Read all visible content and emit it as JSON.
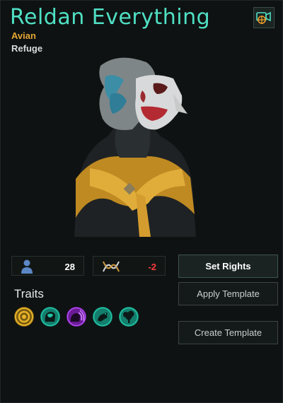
{
  "leader": {
    "name": "Reldan Everything",
    "species": "Avian",
    "rights": "Refuge"
  },
  "icons": {
    "camera_button": "camera-target-icon"
  },
  "stats": {
    "pops": {
      "icon": "person-icon",
      "value": "28"
    },
    "growth": {
      "icon": "dna-icon",
      "value": "-2"
    }
  },
  "traits": {
    "title": "Traits",
    "items": [
      {
        "icon": "ring-gear-trait-icon",
        "color": "#d9a323"
      },
      {
        "icon": "brain-head-trait-icon",
        "color": "#19a58e"
      },
      {
        "icon": "psionic-trait-icon",
        "color": "#9b2fd1"
      },
      {
        "icon": "leaping-creature-trait-icon",
        "color": "#19a58e"
      },
      {
        "icon": "tree-trait-icon",
        "color": "#19a58e"
      }
    ]
  },
  "buttons": {
    "set_rights": "Set Rights",
    "apply_template": "Apply Template",
    "create_template": "Create Template"
  },
  "colors": {
    "title": "#4fe0c4",
    "species": "#e3a634",
    "negative": "#ff3b3b",
    "positive": "#ffffff"
  }
}
